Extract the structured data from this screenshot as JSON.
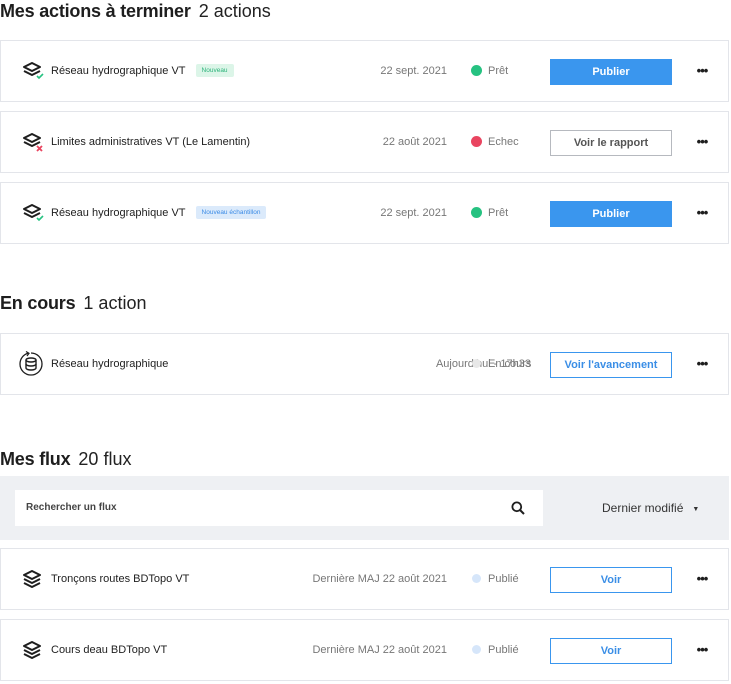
{
  "sections": {
    "todo": {
      "title": "Mes actions à terminer",
      "count": "2 actions"
    },
    "inprogress": {
      "title": "En cours",
      "count": "1 action"
    },
    "flux": {
      "title": "Mes flux",
      "count": "20 flux"
    }
  },
  "todo_items": [
    {
      "name": "Réseau hydrographique VT",
      "badge": "Nouveau",
      "date": "22 sept. 2021",
      "status": "Prêt",
      "action": "Publier"
    },
    {
      "name": "Limites administratives VT (Le Lamentin)",
      "badge": "",
      "date": "22 août 2021",
      "status": "Echec",
      "action": "Voir le rapport"
    },
    {
      "name": "Réseau hydrographique VT",
      "badge": "Nouveau échantillon",
      "date": "22 sept. 2021",
      "status": "Prêt",
      "action": "Publier"
    }
  ],
  "inprogress_items": [
    {
      "name": "Réseau hydrographique",
      "date": "Aujourd'hui - 17h33",
      "status": "En cours",
      "action": "Voir l'avancement"
    }
  ],
  "filter": {
    "search_placeholder": "Rechercher un flux",
    "sort_label": "Dernier modifié"
  },
  "flux_items": [
    {
      "name": "Tronçons routes BDTopo VT",
      "date": "Dernière MAJ 22 août 2021",
      "status": "Publié",
      "action": "Voir"
    },
    {
      "name": "Cours deau BDTopo VT",
      "date": "Dernière MAJ 22 août 2021",
      "status": "Publié",
      "action": "Voir"
    }
  ],
  "more_label": "•••",
  "colors": {
    "primary": "#3a96ee",
    "success": "#26c281",
    "error": "#e94560"
  }
}
